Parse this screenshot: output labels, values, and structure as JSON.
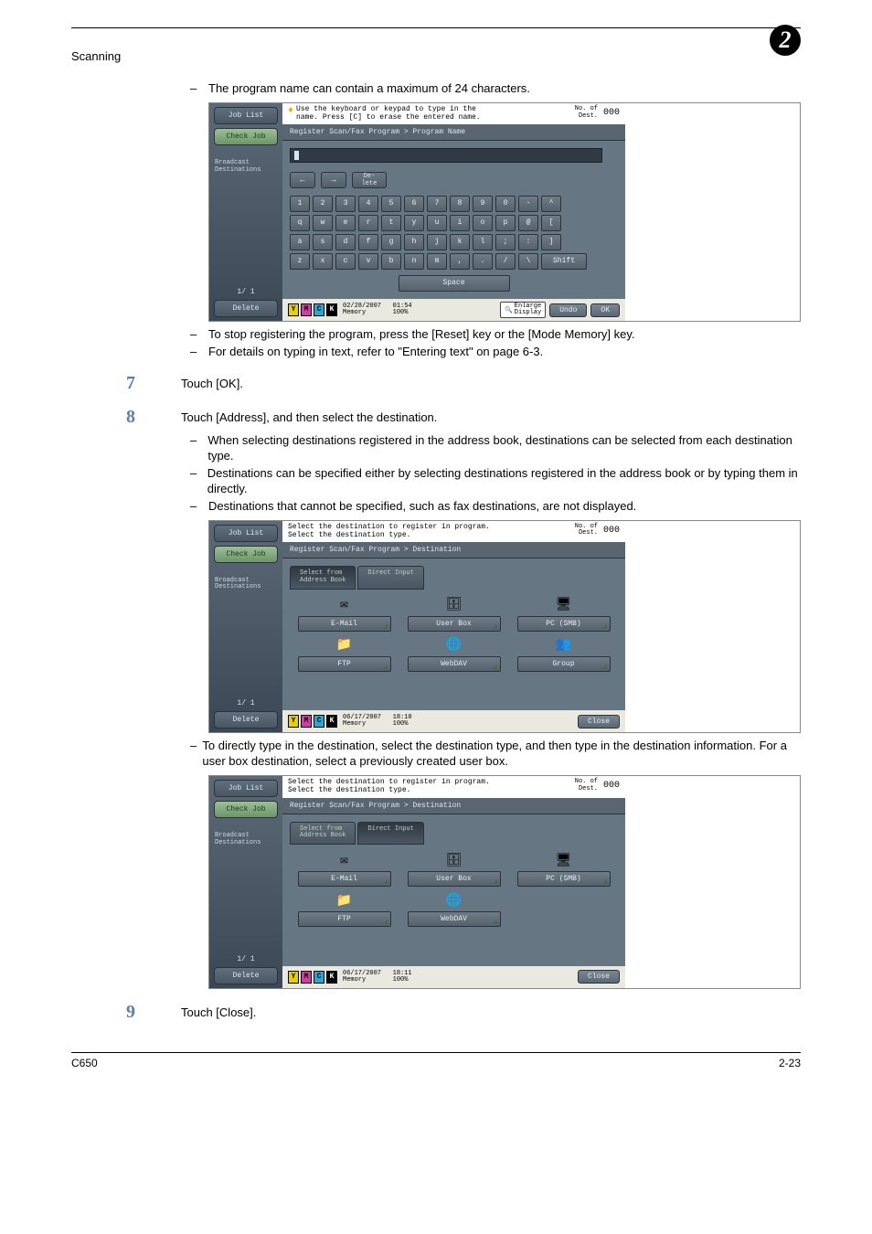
{
  "header": {
    "title": "Scanning",
    "chapter": "2"
  },
  "intro_note": "The program name can contain a maximum of 24 characters.",
  "fig1": {
    "left": {
      "job_list": "Job List",
      "check_job": "Check Job",
      "broadcast": "Broadcast\nDestinations",
      "pager": "1/  1",
      "delete": "Delete"
    },
    "hint_line1": "Use the keyboard or keypad to type in the",
    "hint_line2": "name. Press [C] to erase the entered name.",
    "no_of_label": "No. of\nDest.",
    "no_of_val": "000",
    "subheader": "Register Scan/Fax Program > Program Name",
    "row1": [
      "1",
      "2",
      "3",
      "4",
      "5",
      "6",
      "7",
      "8",
      "9",
      "0",
      "-",
      "^"
    ],
    "row2": [
      "q",
      "w",
      "e",
      "r",
      "t",
      "y",
      "u",
      "i",
      "o",
      "p",
      "@",
      "["
    ],
    "row3": [
      "a",
      "s",
      "d",
      "f",
      "g",
      "h",
      "j",
      "k",
      "l",
      ";",
      ":",
      "]"
    ],
    "row4": [
      "z",
      "x",
      "c",
      "v",
      "b",
      "n",
      "m",
      ",",
      ".",
      "/",
      "\\"
    ],
    "shift": "Shift",
    "space": "Space",
    "del_small": "De-\nlete",
    "footer_date": "02/28/2007",
    "footer_time": "01:54",
    "footer_mem_l": "Memory",
    "footer_mem_v": "100%",
    "enlarge": "Enlarge\nDisplay",
    "undo": "Undo",
    "ok": "OK"
  },
  "post_fig1_notes": [
    "To stop registering the program, press the [Reset] key or the [Mode Memory] key.",
    "For details on typing in text, refer to \"Entering text\" on page 6-3."
  ],
  "step7": {
    "num": "7",
    "text": "Touch [OK]."
  },
  "step8": {
    "num": "8",
    "text": "Touch [Address], and then select the destination.",
    "subnotes": [
      "When selecting destinations registered in the address book, destinations can be selected from each destination type.",
      "Destinations can be specified either by selecting destinations registered in the address book or by typing them in directly.",
      "Destinations that cannot be specified, such as fax destinations, are not displayed."
    ]
  },
  "fig2": {
    "hint_line1": "Select the destination to register in program.",
    "hint_line2": "Select the destination type.",
    "subheader": "Register Scan/Fax Program > Destination",
    "tab1": "Select from\nAddress Book",
    "tab2": "Direct Input",
    "dests": [
      "E-Mail",
      "User Box",
      "PC (SMB)",
      "FTP",
      "WebDAV",
      "Group"
    ],
    "footer_date": "06/17/2007",
    "footer_time": "18:10",
    "close": "Close"
  },
  "mid_note": "To directly type in the destination, select the destination type, and then type in the destination information. For a user box destination, select a previously created user box.",
  "fig3": {
    "tab1": "Select from\nAddress Book",
    "tab2": "Direct Input",
    "dests": [
      "E-Mail",
      "User Box",
      "PC (SMB)",
      "FTP",
      "WebDAV"
    ],
    "footer_date": "06/17/2007",
    "footer_time": "18:11",
    "close": "Close"
  },
  "step9": {
    "num": "9",
    "text": "Touch [Close]."
  },
  "footer": {
    "left": "C650",
    "right": "2-23"
  }
}
